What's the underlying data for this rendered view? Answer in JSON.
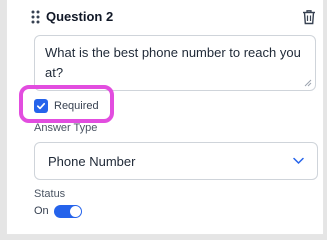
{
  "question": {
    "title": "Question 2",
    "text": "What is the best phone number to reach you at?"
  },
  "required": {
    "label": "Required",
    "checked": true
  },
  "answer_type": {
    "label": "Answer Type",
    "selected": "Phone Number"
  },
  "status": {
    "label": "Status",
    "value_label": "On",
    "enabled": true
  },
  "colors": {
    "accent": "#2563eb",
    "highlight": "#e24ddf"
  },
  "icons": [
    "drag-handle-icon",
    "trash-icon",
    "checkmark-icon",
    "chevron-down-icon",
    "resize-grip-icon"
  ]
}
